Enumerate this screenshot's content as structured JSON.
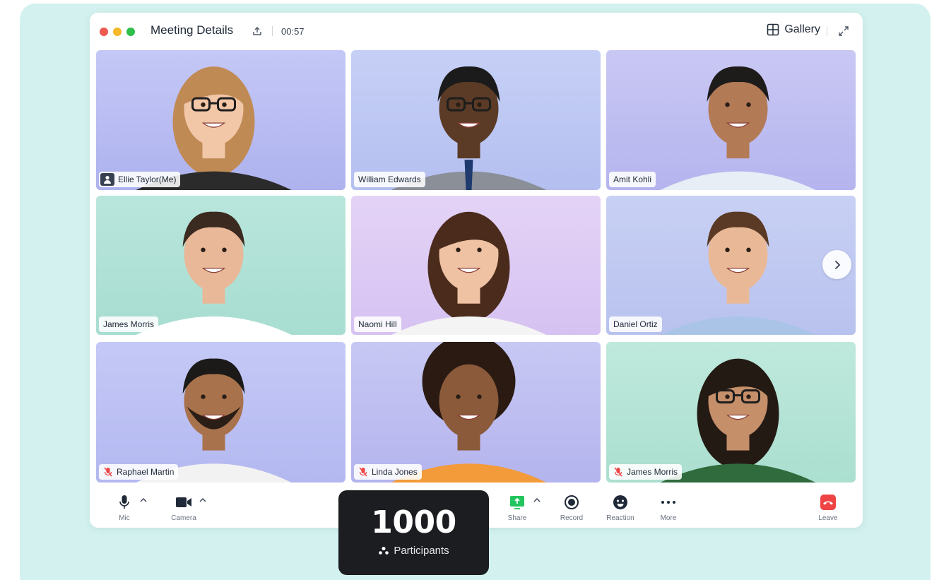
{
  "window": {
    "title": "Meeting Details",
    "timer": "00:57",
    "view_label": "Gallery"
  },
  "participants_tiles": [
    {
      "name": "Ellie Taylor(Me)",
      "is_me": true,
      "muted": false
    },
    {
      "name": "William Edwards",
      "is_me": false,
      "muted": false
    },
    {
      "name": "Amit Kohli",
      "is_me": false,
      "muted": false
    },
    {
      "name": "James Morris",
      "is_me": false,
      "muted": false
    },
    {
      "name": "Naomi Hill",
      "is_me": false,
      "muted": false
    },
    {
      "name": "Daniel Ortiz",
      "is_me": false,
      "muted": false
    },
    {
      "name": "Raphael Martin",
      "is_me": false,
      "muted": true
    },
    {
      "name": "Linda Jones",
      "is_me": false,
      "muted": true
    },
    {
      "name": "James Morris",
      "is_me": false,
      "muted": true
    }
  ],
  "controls": {
    "mic": "Mic",
    "camera": "Camera",
    "share": "Share",
    "record": "Record",
    "reaction": "Reaction",
    "more": "More",
    "leave": "Leave"
  },
  "participants_card": {
    "count": "1000",
    "label": "Participants"
  },
  "colors": {
    "dot_red": "#ee5a52",
    "dot_yellow": "#f5b829",
    "dot_green": "#2fbf4a",
    "share_green": "#22c55e",
    "leave_red": "#ef4444",
    "muted_red": "#ef4444"
  },
  "icons": {
    "share_title": "share-out-icon",
    "gallery": "grid-icon",
    "expand": "expand-icon",
    "next": "chevron-right-icon"
  }
}
